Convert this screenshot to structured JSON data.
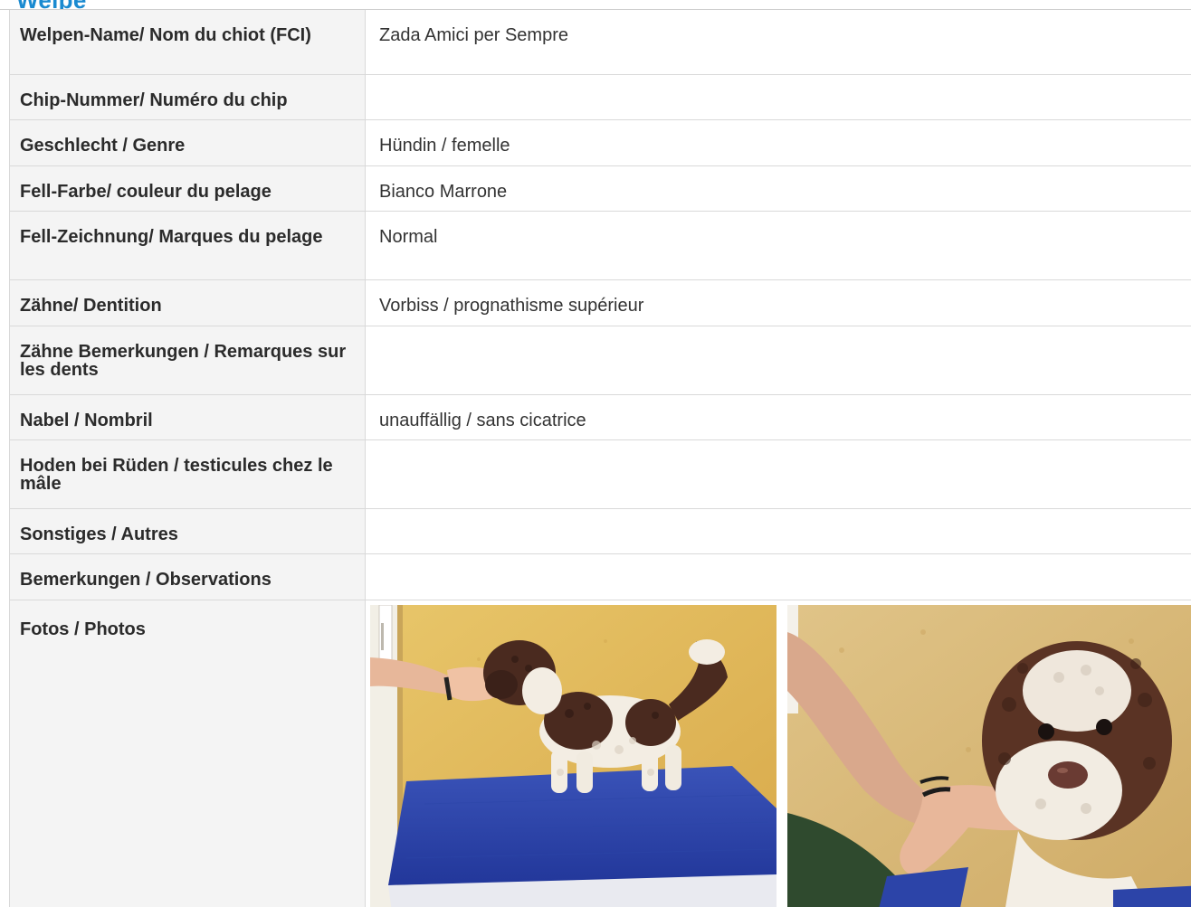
{
  "section": {
    "title": "Welpe"
  },
  "rows": [
    {
      "label": "Welpen-Name/ Nom du chiot (FCI)",
      "value": "Zada Amici per Sempre"
    },
    {
      "label": "Chip-Nummer/ Numéro du chip",
      "value": ""
    },
    {
      "label": "Geschlecht / Genre",
      "value": "Hündin / femelle"
    },
    {
      "label": "Fell-Farbe/ couleur du pelage",
      "value": "Bianco Marrone"
    },
    {
      "label": "Fell-Zeichnung/ Marques du pelage",
      "value": "Normal"
    },
    {
      "label": "Zähne/ Dentition",
      "value": "Vorbiss / prognathisme supérieur"
    },
    {
      "label": "Zähne Bemerkungen / Remarques sur les dents",
      "value": ""
    },
    {
      "label": "Nabel / Nombril",
      "value": "unauffällig / sans cicatrice"
    },
    {
      "label": "Hoden bei Rüden / testicules chez le mâle",
      "value": ""
    },
    {
      "label": "Sonstiges / Autres",
      "value": ""
    },
    {
      "label": "Bemerkungen / Observations",
      "value": ""
    }
  ],
  "photos": {
    "label": "Fotos / Photos",
    "items": [
      {
        "icon": "puppy-standing-photo"
      },
      {
        "icon": "puppy-closeup-photo"
      }
    ]
  },
  "colors": {
    "title_blue": "#1a8ad0",
    "label_bg": "#f4f4f4",
    "border": "#d9d9d9"
  }
}
